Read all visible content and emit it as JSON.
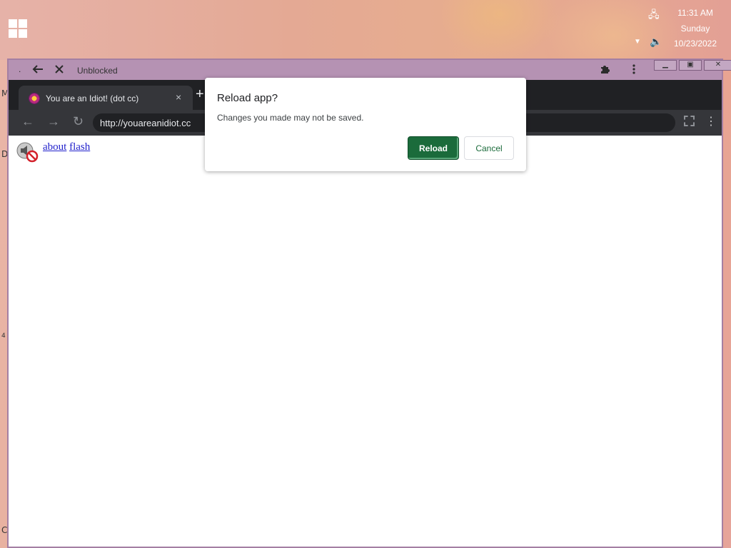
{
  "taskbar": {
    "time": "11:31 AM",
    "day": "Sunday",
    "date": "10/23/2022",
    "network_icon": "network-monitor-icon",
    "volume_icon": "speaker-icon",
    "chevron_icon": "chevron-down-icon",
    "start_icon": "windows-logo-icon"
  },
  "edge_artifacts": [
    "M",
    "D",
    "4",
    "C"
  ],
  "app_window": {
    "title": "Unblocked",
    "dot": ".",
    "back_icon": "arrow-left-icon",
    "stop_icon": "close-icon",
    "extensions_icon": "puzzle-icon",
    "menu_icon": "kebab-menu-icon",
    "controls": [
      "minimize",
      "restore",
      "close"
    ]
  },
  "browser": {
    "tab": {
      "title": "You are an Idiot! (dot cc)",
      "close": "×"
    },
    "new_tab": "+",
    "url": "http://youareanidiot.cc",
    "nav": {
      "back": "←",
      "forward": "→",
      "reload": "↻"
    },
    "menu": "⋮"
  },
  "page": {
    "links": [
      "about",
      "flash"
    ]
  },
  "dialog": {
    "title": "Reload app?",
    "message": "Changes you made may not be saved.",
    "primary": "Reload",
    "secondary": "Cancel"
  },
  "colors": {
    "primary_button": "#1b6b3b",
    "window_border": "#a47fa3",
    "browser_dark": "#202124"
  }
}
